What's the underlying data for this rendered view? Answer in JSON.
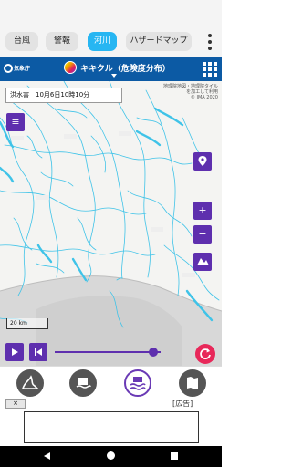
{
  "tabs": [
    {
      "label": "台風"
    },
    {
      "label": "警報"
    },
    {
      "label": "河川"
    },
    {
      "label": "ハザードマップ"
    }
  ],
  "header": {
    "org_label": "気象庁",
    "layer_title": "キキクル（危険度分布）"
  },
  "map": {
    "datetime": "洪水害　10月6日10時10分",
    "attribution": [
      "地理院地図・地理院タイル",
      "を加工して利用",
      "© JMA 2020"
    ],
    "scale_label": "20 km",
    "time_slider_value": 0.93
  },
  "ad": {
    "close_label": "×",
    "label": "[広告]"
  },
  "colors": {
    "accent": "#5e2fae",
    "header": "#0c5aa4",
    "active_tab": "#27b6f2",
    "refresh": "#e8285a",
    "river": "#3fc3e8"
  },
  "icons": [
    "menu-icon",
    "location-pin-icon",
    "zoom-in-icon",
    "zoom-out-icon",
    "layers-icon",
    "play-icon",
    "skip-start-icon",
    "refresh-icon",
    "grid-icon"
  ]
}
